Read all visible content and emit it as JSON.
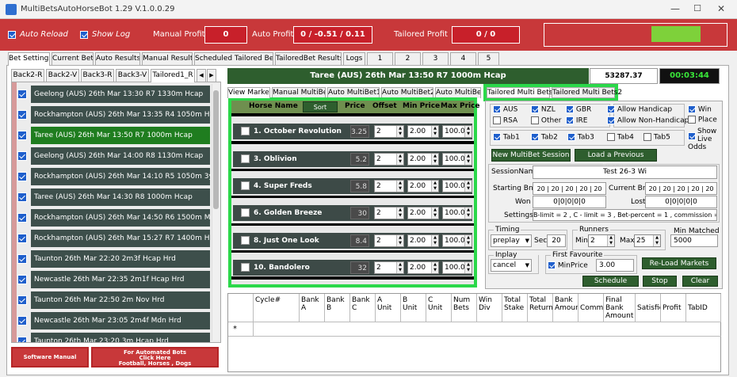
{
  "window": {
    "title": "MultiBetsAutoHorseBot 1.29 V.1.0.0.29"
  },
  "topbar": {
    "auto_reload_label": "Auto Reload",
    "show_log_label": "Show Log",
    "manual_profit_label": "Manual Profit",
    "manual_profit_value": "0",
    "auto_profit_label": "Auto Profit",
    "auto_profit_value": "0 / -0.51 / 0.11",
    "tailored_profit_label": "Tailored Profit",
    "tailored_profit_value": "0 / 0"
  },
  "main_tabs": [
    "Bet Settings",
    "Current Bets",
    "Auto Results",
    "Manual Results",
    "Scheduled Tailored Bets",
    "TailoredBet Results",
    "Logs",
    "1",
    "2",
    "3",
    "4",
    "5"
  ],
  "sub_tabs": [
    "Back2-R",
    "Back2-V",
    "Back3-R",
    "Back3-V",
    "Tailored1_R"
  ],
  "races": [
    {
      "label": "Geelong (AUS) 26th Mar 13:30 R7 1330m Hcap",
      "selected": false
    },
    {
      "label": "Rockhampton (AUS) 26th Mar 13:35 R4 1050m Hcap",
      "selected": false
    },
    {
      "label": "Taree (AUS) 26th Mar 13:50 R7 1000m Hcap",
      "selected": true
    },
    {
      "label": "Geelong (AUS) 26th Mar 14:00 R8 1130m Hcap",
      "selected": false
    },
    {
      "label": "Rockhampton (AUS) 26th Mar 14:10 R5 1050m 3yo",
      "selected": false
    },
    {
      "label": "Taree (AUS) 26th Mar 14:30 R8 1000m Hcap",
      "selected": false
    },
    {
      "label": "Rockhampton (AUS) 26th Mar 14:50 R6 1500m Mdn",
      "selected": false
    },
    {
      "label": "Rockhampton (AUS) 26th Mar 15:27 R7 1400m Hcap",
      "selected": false
    },
    {
      "label": "Taunton 26th Mar 22:20 2m3f Hcap Hrd",
      "selected": false
    },
    {
      "label": "Newcastle 26th Mar 22:35 2m1f Hcap Hrd",
      "selected": false
    },
    {
      "label": "Taunton 26th Mar 22:50 2m Nov Hrd",
      "selected": false
    },
    {
      "label": "Newcastle 26th Mar 23:05 2m4f Mdn Hrd",
      "selected": false
    },
    {
      "label": "Taunton 26th Mar 23:20 3m Hcap Hrd",
      "selected": false
    }
  ],
  "bottom_buttons": {
    "software_manual": "Software Manual",
    "automated_line1": "For Automated Bots",
    "automated_line2": "Click Here",
    "automated_line3": "Football, Horses , Dogs"
  },
  "race_header": {
    "title": "Taree (AUS) 26th Mar 13:50 R7 1000m Hcap",
    "balance": "53287.37",
    "timer": "00:03:44"
  },
  "market_tabs": [
    "View Market",
    "Manual MultiBets",
    "Auto MultiBet1",
    "Auto MultiBet2",
    "Auto MultiBet3"
  ],
  "table_headers": {
    "horse_name": "Horse Name",
    "sort": "Sort",
    "price": "Price",
    "offset": "Offset",
    "min_price": "Min Price",
    "max_price": "Max Price"
  },
  "horses": [
    {
      "name": "1. October Revolution",
      "price": "3.25",
      "offset": "2",
      "min": "2.00",
      "max": "100.0"
    },
    {
      "name": "3. Oblivion",
      "price": "5.2",
      "offset": "2",
      "min": "2.00",
      "max": "100.0"
    },
    {
      "name": "4. Super Freds",
      "price": "5.8",
      "offset": "2",
      "min": "2.00",
      "max": "100.0"
    },
    {
      "name": "6. Golden Breeze",
      "price": "30",
      "offset": "2",
      "min": "2.00",
      "max": "100.0"
    },
    {
      "name": "8. Just One Look",
      "price": "8.4",
      "offset": "2",
      "min": "2.00",
      "max": "100.0"
    },
    {
      "name": "10. Bandolero",
      "price": "32",
      "offset": "2",
      "min": "2.00",
      "max": "100.0"
    }
  ],
  "tailored_tabs": [
    "Tailored Multi Bets1",
    "Tailored Multi Bets2"
  ],
  "regions": {
    "aus": "AUS",
    "nzl": "NZL",
    "gbr": "GBR",
    "rsa": "RSA",
    "other": "Other",
    "ire": "IRE"
  },
  "handicap": {
    "allow": "Allow Handicap",
    "allow_non": "Allow Non-Handicap"
  },
  "bet_types": {
    "win": "Win",
    "place": "Place",
    "show_live": "Show Live Odds"
  },
  "tabs_chk": [
    "Tab1",
    "Tab2",
    "Tab3",
    "Tab4",
    "Tab5"
  ],
  "session_buttons": {
    "new": "New MultiBet Session",
    "load": "Load a Previous Session"
  },
  "session": {
    "name_label": "SessionName",
    "name_value": "Test 26-3 Wi",
    "start_label": "Starting Bnk",
    "start_value": "20 | 20 | 20 | 20 | 20",
    "current_label": "Current Bnk",
    "current_value": "20 | 20 | 20 | 20 | 20",
    "won_label": "Won",
    "won_value": "0|0|0|0|0",
    "lost_label": "Lost",
    "lost_value": "0|0|0|0|0",
    "settings_label": "Settings",
    "settings_value": "B-limit = 2 , C - limit = 3 , Bet-percent = 1 , commission = 8"
  },
  "timing": {
    "label": "Timing",
    "mode": "preplay",
    "sec_label": "Sec",
    "sec_value": "20"
  },
  "runners": {
    "label": "Runners",
    "min_label": "Min",
    "min_value": "2",
    "max_label": "Max",
    "max_value": "25"
  },
  "min_matched": {
    "label": "Min Matched",
    "value": "5000"
  },
  "inplay": {
    "label": "Inplay Action",
    "value": "cancel"
  },
  "first_fav": {
    "label": "First Favourite",
    "minprice_label": "MinPrice",
    "minprice_value": "3.00"
  },
  "action_buttons": {
    "reload": "Re-Load Markets",
    "schedule": "Schedule",
    "stop": "Stop",
    "clear": "Clear"
  },
  "grid_headers": [
    "Cycle#",
    "Bank A",
    "Bank B",
    "Bank C",
    "A Unit",
    "B Unit",
    "C Unit",
    "Num Bets",
    "Win Div",
    "Total Stake",
    "Total Return",
    "Bank Amount",
    "Comm",
    "Final Bank Amount",
    "Satisfied",
    "Profit",
    "TabID"
  ],
  "grid_new_row_marker": "*",
  "colors": {
    "red": "#c8383a",
    "dark_row": "#3d4f4b",
    "selected_row": "#1f7d1f",
    "highlight": "#2bd84a",
    "lime": "#7ed13a"
  }
}
